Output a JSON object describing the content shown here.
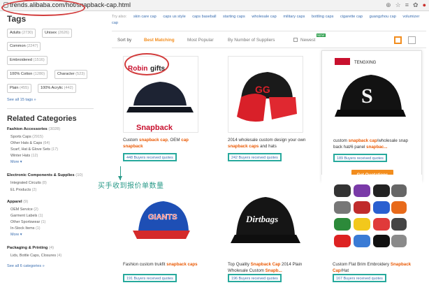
{
  "browser": {
    "url": "trends.alibaba.com/hot/snapback-cap.html",
    "icons": [
      "zoom-icon",
      "star-icon",
      "settings-icon",
      "extension-icon",
      "pinterest-icon"
    ]
  },
  "tags": {
    "title": "Tags",
    "items": [
      {
        "name": "Adults",
        "count": "(2730)"
      },
      {
        "name": "Unisex",
        "count": "(2626)"
      },
      {
        "name": "Common",
        "count": "(2247)"
      },
      {
        "name": "Embroidered",
        "count": "(1516)"
      },
      {
        "name": "100% Cotton",
        "count": "(1280)"
      },
      {
        "name": "Character",
        "count": "(523)"
      },
      {
        "name": "Plain",
        "count": "(455)"
      },
      {
        "name": "100% Acrylic",
        "count": "(442)"
      }
    ],
    "see_all": "See all 15 tags »"
  },
  "related": {
    "title": "Related Categories",
    "groups": [
      {
        "name": "Fashion Accessories",
        "count": "(3028)",
        "subs": [
          {
            "name": "Sports Caps",
            "count": "(2915)"
          },
          {
            "name": "Other Hats & Caps",
            "count": "(64)"
          },
          {
            "name": "Scarf, Hat & Glove Sets",
            "count": "(17)"
          },
          {
            "name": "Winter Hats",
            "count": "(12)"
          }
        ]
      },
      {
        "name": "Electronic Components & Supplies",
        "count": "(10)",
        "subs": [
          {
            "name": "Integrated Circuits",
            "count": "(8)"
          },
          {
            "name": "EL Products",
            "count": "(2)"
          }
        ]
      },
      {
        "name": "Apparel",
        "count": "(9)",
        "subs": [
          {
            "name": "OEM Service",
            "count": "(2)"
          },
          {
            "name": "Garment Labels",
            "count": "(1)"
          },
          {
            "name": "Other Sportswear",
            "count": "(1)"
          },
          {
            "name": "In-Stock Items",
            "count": "(1)"
          }
        ]
      },
      {
        "name": "Packaging & Printing",
        "count": "(4)",
        "subs": [
          {
            "name": "Lids, Bottle Caps, Closures",
            "count": "(4)"
          }
        ]
      }
    ],
    "more": "More ▾",
    "see_all": "See all 6 categories »"
  },
  "try_also": {
    "label": "Try also:",
    "terms": [
      "skin care cap",
      "caps us style",
      "caps baseball",
      "starting caps",
      "wholesale cap",
      "military caps",
      "bottling caps",
      "cigarette cap",
      "guangzhou cap",
      "volumizer cap"
    ]
  },
  "sort": {
    "label": "Sort by",
    "options": [
      "Best Matching",
      "Most Popular",
      "By Number of Suppliers",
      "Newest"
    ],
    "new_badge": "NEW"
  },
  "products": [
    {
      "pre": "Custom ",
      "hl1": "snapback cap",
      "mid": ", OEM ",
      "hl2": "cap snapback",
      "post": "",
      "buyers": "448 Buyers received quotes",
      "brand": "Robingifts",
      "print": "Snapback"
    },
    {
      "pre": "2014 wholesale custom design your own ",
      "hl1": "snapback caps",
      "mid": " and hats",
      "hl2": "",
      "post": "",
      "buyers": "242 Buyers received quotes",
      "brand": "",
      "print": "GG"
    },
    {
      "pre": "custom ",
      "hl1": "snapback cap",
      "mid": "/wholesale snap back hat/6 panel ",
      "hl2": "snapbac...",
      "post": "",
      "buyers": "189 Buyers received quotes",
      "brand": "TENGXING",
      "print": "S",
      "button": "Get Quotations"
    },
    {
      "pre": "Fashion custom trukfit ",
      "hl1": "snapback caps",
      "mid": "",
      "hl2": "",
      "post": "",
      "buyers": "191 Buyers received quotes",
      "brand": "",
      "print": "GIANTS"
    },
    {
      "pre": "Top Quality ",
      "hl1": "Snapback Cap",
      "mid": " 2014 Plain Wholesale Custom ",
      "hl2": "Snapb...",
      "post": "",
      "buyers": "196 Buyers received quotes",
      "brand": "",
      "print": "Dirtbags"
    },
    {
      "pre": "Custom Flat Brim Embroidery ",
      "hl1": "Snapback Cap",
      "mid": "/Hat",
      "hl2": "",
      "post": "",
      "buyers": "167 Buyers received quotes",
      "brand": "",
      "print": ""
    }
  ],
  "annotation": "买手收到报价单数量",
  "colors": {
    "accent": "#f28d1e",
    "highlight": "#ea5a05",
    "annot": "#2c9b8a",
    "circle": "#d23c3c"
  }
}
